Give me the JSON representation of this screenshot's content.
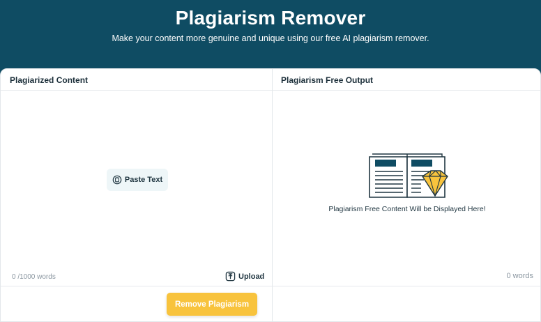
{
  "hero": {
    "title": "Plagiarism Remover",
    "subtitle": "Make your content more genuine and unique using our free AI plagiarism remover."
  },
  "input_pane": {
    "header": "Plagiarized Content",
    "paste_label": "Paste Text",
    "word_count": "0 /1000 words",
    "upload_label": "Upload",
    "submit_label": "Remove Plagiarism"
  },
  "output_pane": {
    "header": "Plagiarism Free Output",
    "placeholder": "Plagiarism Free Content Will be Displayed Here!",
    "word_count": "0 words"
  },
  "colors": {
    "hero_bg": "#0f4c63",
    "accent": "#f8c33d",
    "text_dark": "#1f3540",
    "muted": "#8a96a0"
  },
  "icons": {
    "paste": "clipboard-icon",
    "upload": "upload-icon",
    "illustration": "book-diamond-illustration"
  }
}
